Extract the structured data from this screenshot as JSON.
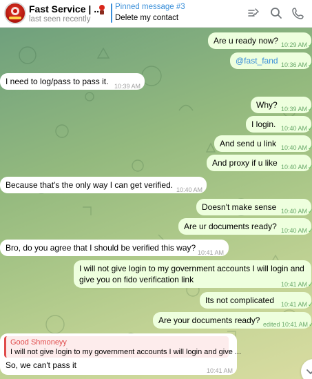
{
  "header": {
    "title": "Fast Service | ...",
    "status": "last seen recently",
    "pinned_title": "Pinned message #3",
    "pinned_text": "Delete my contact",
    "icons": [
      "pin-list-icon",
      "search-icon",
      "phone-icon"
    ]
  },
  "messages": [
    {
      "side": "out",
      "text": "Are u ready now?",
      "time": "10:29 AM"
    },
    {
      "side": "out",
      "text": "@fast_fand",
      "time": "10:36 AM",
      "is_link": true
    },
    {
      "side": "in",
      "text": "I need to log/pass to pass it.",
      "time": "10:39 AM"
    },
    {
      "side": "out",
      "text": "Why?",
      "time": "10:39 AM"
    },
    {
      "side": "out",
      "text": "I login.",
      "time": "10:40 AM"
    },
    {
      "side": "out",
      "text": "And send u link",
      "time": "10:40 AM"
    },
    {
      "side": "out",
      "text": "And proxy if u like",
      "time": "10:40 AM"
    },
    {
      "side": "in",
      "text": "Because that's the only way I can get verified.",
      "time": "10:40 AM"
    },
    {
      "side": "out",
      "text": "Doesn't make sense",
      "time": "10:40 AM"
    },
    {
      "side": "out",
      "text": "Are ur documents ready?",
      "time": "10:40 AM"
    },
    {
      "side": "in",
      "text": "Bro, do you agree that I should be verified this way?",
      "time": "10:41 AM"
    },
    {
      "side": "out",
      "text_line1": "I will not give login to my government accounts I will login and",
      "text_line2": "give you on fido verification link",
      "time": "10:41 AM"
    },
    {
      "side": "out",
      "text": "Its not complicated",
      "time": "10:41 AM"
    },
    {
      "side": "out",
      "text": "Are your documents ready?",
      "time": "edited 10:41 AM"
    },
    {
      "side": "in",
      "reply_name": "Good Shmoneyy",
      "reply_text": "I will not give login to my government accounts I will login and give ...",
      "text": "So, we can't pass it",
      "time": "10:41 AM"
    }
  ],
  "colors": {
    "outgoing_bubble": "#eeffde",
    "incoming_bubble": "#ffffff",
    "accent": "#3a8fd9",
    "reply_accent": "#e04b4b"
  }
}
